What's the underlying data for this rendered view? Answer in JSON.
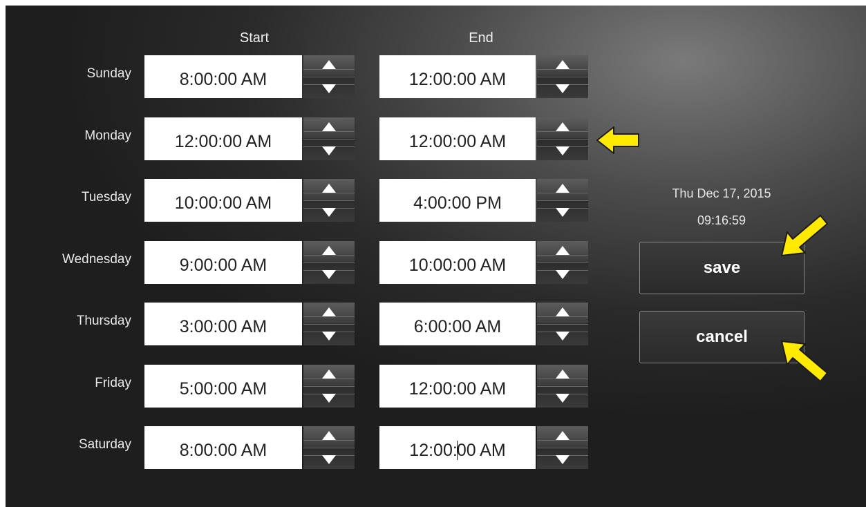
{
  "columns": {
    "start": "Start",
    "end": "End"
  },
  "rows": [
    {
      "day": "Sunday",
      "start": "8:00:00 AM",
      "end": "12:00:00 AM"
    },
    {
      "day": "Monday",
      "start": "12:00:00 AM",
      "end": "12:00:00 AM"
    },
    {
      "day": "Tuesday",
      "start": "10:00:00 AM",
      "end": "4:00:00 PM"
    },
    {
      "day": "Wednesday",
      "start": "9:00:00 AM",
      "end": "10:00:00 AM"
    },
    {
      "day": "Thursday",
      "start": "3:00:00 AM",
      "end": "6:00:00 AM"
    },
    {
      "day": "Friday",
      "start": "5:00:00 AM",
      "end": "12:00:00 AM"
    },
    {
      "day": "Saturday",
      "start": "8:00:00 AM",
      "end": "12:00:00 AM"
    }
  ],
  "saturday_end_parts": [
    "12:00:",
    "00 AM"
  ],
  "clock": {
    "date": "Thu Dec 17, 2015",
    "time": "09:16:59"
  },
  "buttons": {
    "save": "save",
    "cancel": "cancel"
  },
  "annotation_arrows": [
    "arrow-left-icon",
    "arrow-down-left-icon",
    "arrow-up-left-icon"
  ],
  "colors": {
    "arrow_fill": "#ffea00",
    "arrow_stroke": "#1a1a1a",
    "panel_bg": "#2a2a2a",
    "field_bg": "#ffffff"
  }
}
